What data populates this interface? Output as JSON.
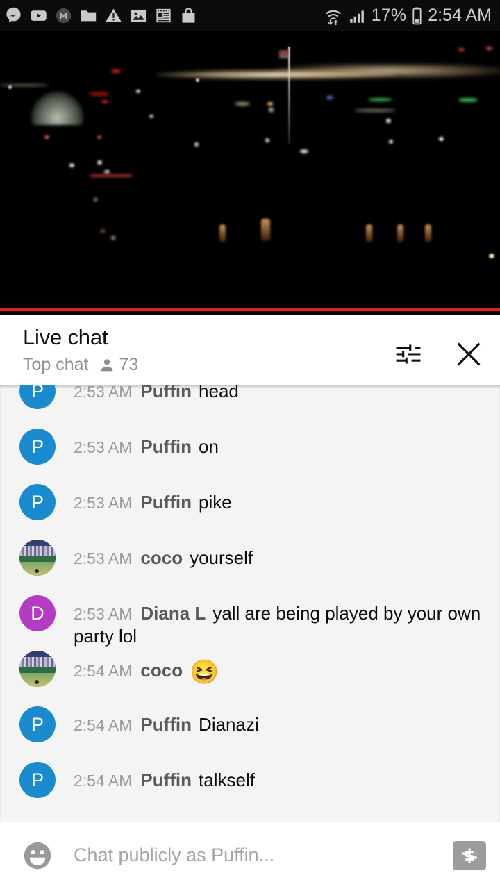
{
  "status_bar": {
    "icons": [
      "messenger-m-icon",
      "youtube-play-icon",
      "muted-m-icon",
      "folder-icon",
      "warning-triangle-icon",
      "image-icon",
      "news-reader-icon",
      "shopping-bag-icon"
    ],
    "wifi_icon": "wifi-transfer-icon",
    "signal_icon": "cellular-signal-icon",
    "battery_percent": "17%",
    "battery_icon": "battery-low-icon",
    "clock": "2:54 AM"
  },
  "video": {
    "name": "live-video-player",
    "description": "night cityscape",
    "progress_color": "#e52117"
  },
  "chat_header": {
    "title": "Live chat",
    "mode_label": "Top chat",
    "viewer_icon": "person-icon",
    "viewer_count": "73",
    "settings_icon": "tune-sliders-icon",
    "close_icon": "close-x-icon"
  },
  "messages": [
    {
      "time": "2:53 AM",
      "author": "Puffin",
      "text": "head",
      "emoji": "",
      "avatar_type": "letter",
      "avatar_letter": "P",
      "avatar_color": "#1b8bd0"
    },
    {
      "time": "2:53 AM",
      "author": "Puffin",
      "text": "on",
      "emoji": "",
      "avatar_type": "letter",
      "avatar_letter": "P",
      "avatar_color": "#1b8bd0"
    },
    {
      "time": "2:53 AM",
      "author": "Puffin",
      "text": "pike",
      "emoji": "",
      "avatar_type": "letter",
      "avatar_letter": "P",
      "avatar_color": "#1b8bd0"
    },
    {
      "time": "2:53 AM",
      "author": "coco",
      "text": "yourself",
      "emoji": "",
      "avatar_type": "photo",
      "avatar_letter": "",
      "avatar_color": "#3d6e4a"
    },
    {
      "time": "2:53 AM",
      "author": "Diana L",
      "text": "yall are being played by your own party lol",
      "emoji": "",
      "avatar_type": "letter",
      "avatar_letter": "D",
      "avatar_color": "#b33cc0"
    },
    {
      "time": "2:54 AM",
      "author": "coco",
      "text": "",
      "emoji": "😆",
      "avatar_type": "photo",
      "avatar_letter": "",
      "avatar_color": "#3d6e4a"
    },
    {
      "time": "2:54 AM",
      "author": "Puffin",
      "text": "Dianazi",
      "emoji": "",
      "avatar_type": "letter",
      "avatar_letter": "P",
      "avatar_color": "#1b8bd0"
    },
    {
      "time": "2:54 AM",
      "author": "Puffin",
      "text": "talkself",
      "emoji": "",
      "avatar_type": "letter",
      "avatar_letter": "P",
      "avatar_color": "#1b8bd0"
    }
  ],
  "input_bar": {
    "emoji_icon": "smiley-face-icon",
    "placeholder": "Chat publicly as Puffin...",
    "value": "",
    "superchat_icon": "dollar-bill-icon"
  }
}
